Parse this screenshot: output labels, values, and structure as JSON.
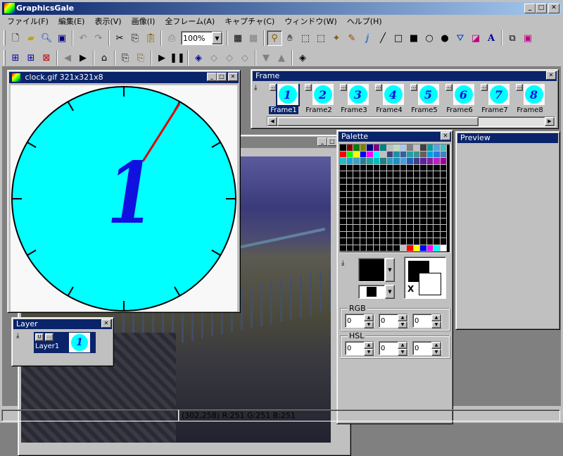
{
  "app": {
    "title": "GraphicsGale"
  },
  "menu": [
    "ファイル(F)",
    "編集(E)",
    "表示(V)",
    "画像(I)",
    "全フレーム(A)",
    "キャプチャ(C)",
    "ウィンドウ(W)",
    "ヘルプ(H)"
  ],
  "toolbar": {
    "zoom_value": "100%"
  },
  "clock_window": {
    "title": "clock.gif 321x321x8",
    "hand_number": "1"
  },
  "frame_window": {
    "title": "Frame",
    "frames": [
      {
        "label": "Frame1",
        "num": "1"
      },
      {
        "label": "Frame2",
        "num": "2"
      },
      {
        "label": "Frame3",
        "num": "3"
      },
      {
        "label": "Frame4",
        "num": "4"
      },
      {
        "label": "Frame5",
        "num": "5"
      },
      {
        "label": "Frame6",
        "num": "6"
      },
      {
        "label": "Frame7",
        "num": "7"
      },
      {
        "label": "Frame8",
        "num": "8"
      }
    ]
  },
  "palette_window": {
    "title": "Palette",
    "rgb_label": "RGB",
    "hsl_label": "HSL",
    "rgb_values": [
      "0",
      "0",
      "0"
    ],
    "hsl_values": [
      "0",
      "0",
      "0"
    ],
    "colors_row1": [
      "#000000",
      "#800000",
      "#008000",
      "#808000",
      "#000080",
      "#800080",
      "#008080",
      "#c0c0c0",
      "#c0dcc0",
      "#a6caf0",
      "#808080",
      "#c0c0c0",
      "#404040",
      "#00a0a0",
      "#60a0e0",
      "#40c0c0"
    ],
    "colors_row2": [
      "#ff0000",
      "#00ff00",
      "#ffff00",
      "#0000ff",
      "#ff00ff",
      "#00ffff",
      "#c0c0c0",
      "#404080",
      "#2090a0",
      "#3060a0",
      "#20a0a0",
      "#409090",
      "#606060",
      "#00a0e0",
      "#2080e0",
      "#4080c0"
    ],
    "colors_row3": [
      "#20c0c0",
      "#20a0e0",
      "#40a0c0",
      "#2080a0",
      "#20a0a0",
      "#00c0c0",
      "#208080",
      "#20a0c0",
      "#2090c0",
      "#40a0e0",
      "#2060c0",
      "#404080",
      "#6020a0",
      "#8020a0",
      "#c020c0",
      "#a000a0"
    ],
    "colors_last": [
      "#000000",
      "#000000",
      "#000000",
      "#000000",
      "#000000",
      "#000000",
      "#000000",
      "#000000",
      "#000000",
      "#c0c0c0",
      "#ff0000",
      "#ffff00",
      "#0000ff",
      "#ff00ff",
      "#00ffff",
      "#ffffff"
    ],
    "fg_color": "#000000",
    "bg_color": "#ffffff",
    "swap_label": "X"
  },
  "preview_window": {
    "title": "Preview"
  },
  "layer_window": {
    "title": "Layer",
    "layer_name": "Layer1",
    "layer_num": "1"
  },
  "status": {
    "text": "(302,258) R:251 G:251 B:251"
  }
}
